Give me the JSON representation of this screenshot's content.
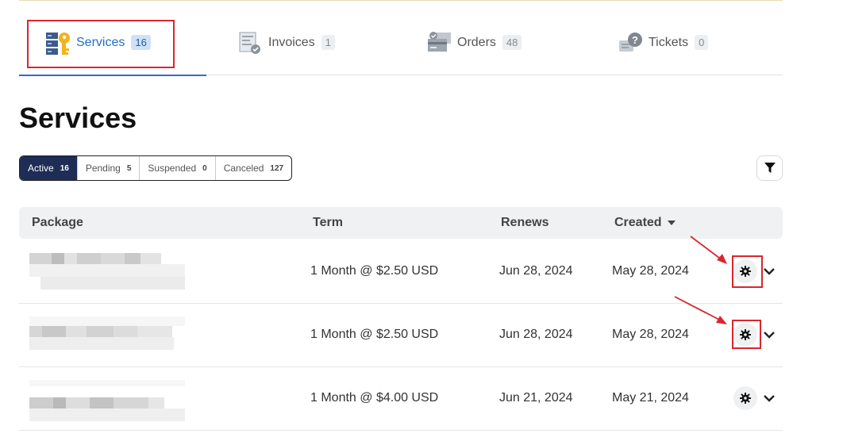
{
  "tabs": [
    {
      "label": "Services",
      "count": "16",
      "icon": "services-key-server-icon",
      "active": true
    },
    {
      "label": "Invoices",
      "count": "1",
      "icon": "invoice-icon",
      "active": false
    },
    {
      "label": "Orders",
      "count": "48",
      "icon": "orders-icon",
      "active": false
    },
    {
      "label": "Tickets",
      "count": "0",
      "icon": "tickets-icon",
      "active": false
    }
  ],
  "page_title": "Services",
  "status_filters": [
    {
      "label": "Active",
      "count": "16",
      "active": true
    },
    {
      "label": "Pending",
      "count": "5",
      "active": false
    },
    {
      "label": "Suspended",
      "count": "0",
      "active": false
    },
    {
      "label": "Canceled",
      "count": "127",
      "active": false
    }
  ],
  "filter_icon": "funnel-icon",
  "table": {
    "headers": {
      "package": "Package",
      "term": "Term",
      "renews": "Renews",
      "created": "Created"
    },
    "sort_indicator": "caret-down-icon",
    "rows": [
      {
        "term": "1 Month @ $2.50 USD",
        "renews": "Jun 28, 2024",
        "created": "May 28, 2024",
        "highlighted": true
      },
      {
        "term": "1 Month @ $2.50 USD",
        "renews": "Jun 28, 2024",
        "created": "May 28, 2024",
        "highlighted": true
      },
      {
        "term": "1 Month @ $4.00 USD",
        "renews": "Jun 21, 2024",
        "created": "May 21, 2024",
        "highlighted": false
      }
    ]
  },
  "colors": {
    "accent": "#1f6fc6",
    "dark_navy": "#1e2d55",
    "annotation_red": "#d9262e"
  }
}
